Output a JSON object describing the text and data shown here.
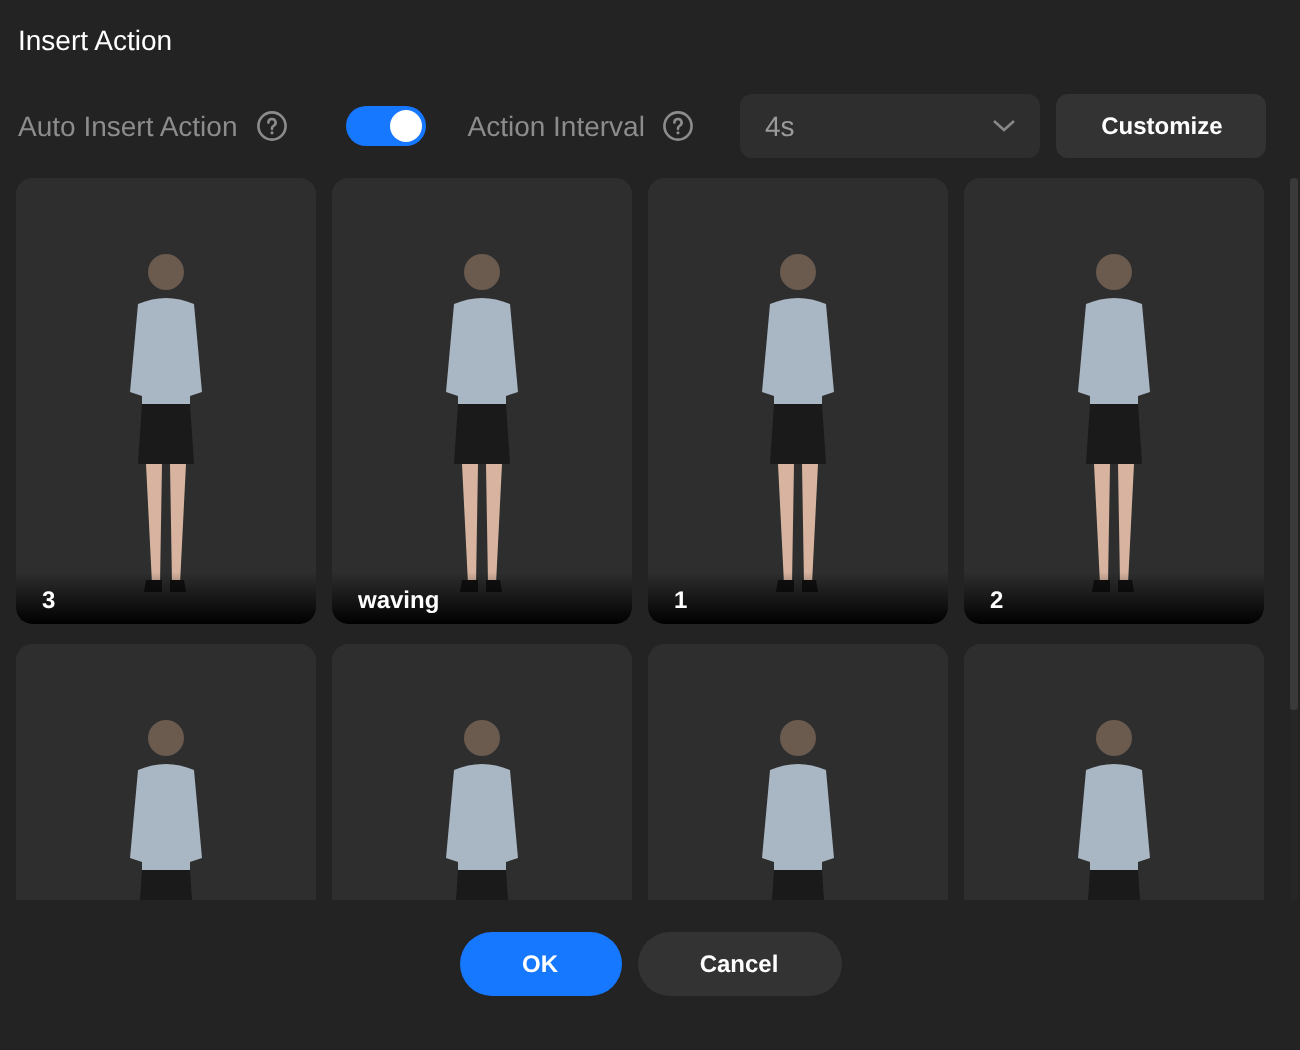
{
  "dialog": {
    "title": "Insert Action"
  },
  "auto_insert": {
    "label": "Auto Insert Action",
    "on": true
  },
  "interval": {
    "label": "Action Interval",
    "value": "4s"
  },
  "customize_button": "Customize",
  "actions": [
    {
      "kind": "labeled",
      "label": "3"
    },
    {
      "kind": "labeled",
      "label": "waving"
    },
    {
      "kind": "labeled",
      "label": "1"
    },
    {
      "kind": "labeled",
      "label": "2"
    },
    {
      "kind": "cut_off"
    },
    {
      "kind": "cut_off"
    },
    {
      "kind": "cut_off"
    },
    {
      "kind": "cut_off"
    }
  ],
  "buttons": [
    {
      "kind": "primary",
      "label": "OK"
    },
    {
      "kind": "secondary",
      "label": "Cancel"
    }
  ]
}
